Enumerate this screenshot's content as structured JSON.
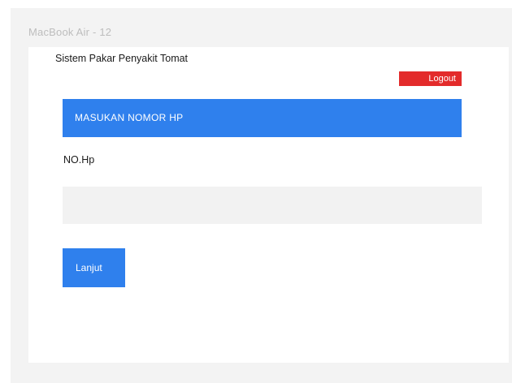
{
  "frame": {
    "label": "MacBook Air - 12"
  },
  "app": {
    "title": "Sistem Pakar Penyakit Tomat"
  },
  "header": {
    "logout_label": "Logout"
  },
  "form": {
    "section_title": "MASUKAN NOMOR HP",
    "phone_label": "NO.Hp",
    "phone_value": "",
    "phone_placeholder": "",
    "next_label": "Lanjut"
  },
  "colors": {
    "primary": "#2f80ed",
    "danger": "#e32b2b",
    "input_bg": "#f2f2f2",
    "canvas_bg": "#f3f3f3"
  }
}
